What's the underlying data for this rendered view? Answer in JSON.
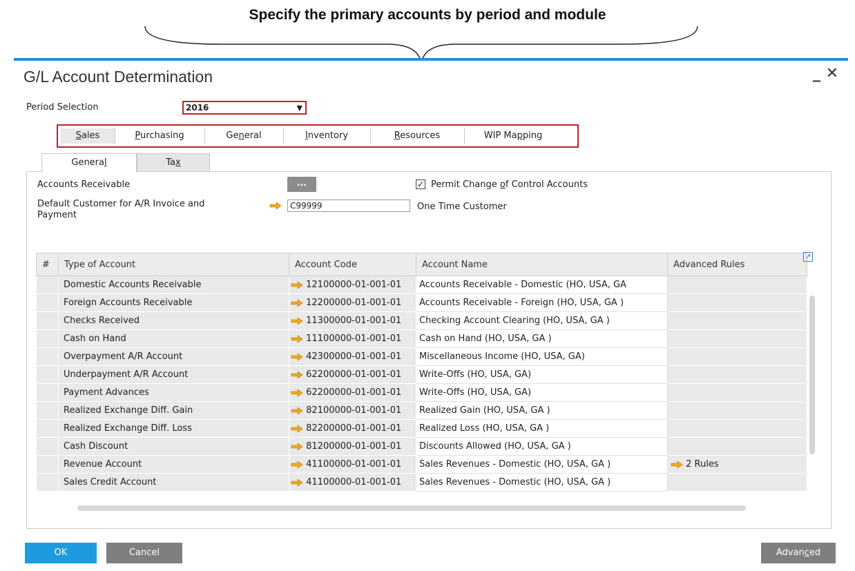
{
  "banner": {
    "title": "Specify the primary accounts by period and module"
  },
  "window": {
    "title": "G/L Account Determination",
    "minimize": "_",
    "close": "✕"
  },
  "period": {
    "label": "Period Selection",
    "value": "2016"
  },
  "main_tabs": [
    {
      "pre": "",
      "u": "S",
      "post": "ales"
    },
    {
      "pre": "",
      "u": "P",
      "post": "urchasing"
    },
    {
      "pre": "Ge",
      "u": "n",
      "post": "eral"
    },
    {
      "pre": "",
      "u": "I",
      "post": "nventory"
    },
    {
      "pre": "",
      "u": "R",
      "post": "esources"
    },
    {
      "pre": "WIP Ma",
      "u": "p",
      "post": "ping"
    }
  ],
  "sub_tabs": [
    {
      "pre": "Genera",
      "u": "l",
      "post": ""
    },
    {
      "pre": "Ta",
      "u": "x",
      "post": ""
    }
  ],
  "form": {
    "accounts_receivable_label": "Accounts Receivable",
    "dots_button": "...",
    "permit_change": {
      "pre": "Permit Change ",
      "u": "o",
      "post": "f Control Accounts",
      "checked": "✓"
    },
    "default_customer_label_1": "Default Customer for A/R Invoice and",
    "default_customer_label_2": "Payment",
    "default_customer_value": "C99999",
    "default_customer_name": "One Time Customer"
  },
  "table": {
    "headers": [
      "#",
      "Type of Account",
      "Account Code",
      "Account Name",
      "Advanced Rules"
    ],
    "rows": [
      {
        "type": "Domestic Accounts Receivable",
        "code": "12100000-01-001-01",
        "name": "Accounts Receivable - Domestic (HO, USA, GA",
        "rules": ""
      },
      {
        "type": "Foreign Accounts Receivable",
        "code": "12200000-01-001-01",
        "name": "Accounts Receivable - Foreign (HO, USA, GA )",
        "rules": ""
      },
      {
        "type": "Checks Received",
        "code": "11300000-01-001-01",
        "name": "Checking Account Clearing (HO, USA, GA )",
        "rules": ""
      },
      {
        "type": "Cash on Hand",
        "code": "11100000-01-001-01",
        "name": "Cash on Hand (HO, USA, GA )",
        "rules": ""
      },
      {
        "type": "Overpayment A/R Account",
        "code": "42300000-01-001-01",
        "name": "Miscellaneous Income (HO, USA, GA)",
        "rules": ""
      },
      {
        "type": "Underpayment A/R Account",
        "code": "62200000-01-001-01",
        "name": "Write-Offs (HO, USA, GA)",
        "rules": ""
      },
      {
        "type": "Payment Advances",
        "code": "62200000-01-001-01",
        "name": "Write-Offs (HO, USA, GA)",
        "rules": ""
      },
      {
        "type": "Realized Exchange Diff. Gain",
        "code": "82100000-01-001-01",
        "name": "Realized Gain (HO, USA, GA )",
        "rules": ""
      },
      {
        "type": "Realized Exchange Diff. Loss",
        "code": "82200000-01-001-01",
        "name": "Realized Loss (HO, USA, GA )",
        "rules": ""
      },
      {
        "type": "Cash Discount",
        "code": "81200000-01-001-01",
        "name": "Discounts Allowed (HO, USA, GA )",
        "rules": ""
      },
      {
        "type": "Revenue Account",
        "code": "41100000-01-001-01",
        "name": "Sales Revenues - Domestic (HO, USA, GA )",
        "rules": "2 Rules"
      },
      {
        "type": "Sales Credit Account",
        "code": "41100000-01-001-01",
        "name": "Sales Revenues - Domestic (HO, USA, GA )",
        "rules": ""
      }
    ]
  },
  "buttons": {
    "ok": "OK",
    "cancel": "Cancel",
    "advanced": {
      "pre": "Advan",
      "u": "c",
      "post": "ed"
    }
  },
  "colors": {
    "accent": "#2a8fd8",
    "highlight_border": "#c0202a",
    "link_arrow": "#f0a81e",
    "ok_button": "#1e9be0",
    "gray_button": "#7f7f7f"
  },
  "icons": {
    "link_arrow": "orange-right-arrow-icon",
    "expand": "expand-arrow-icon",
    "dropdown": "dropdown-triangle-icon",
    "checkbox": "checkmark-icon"
  }
}
